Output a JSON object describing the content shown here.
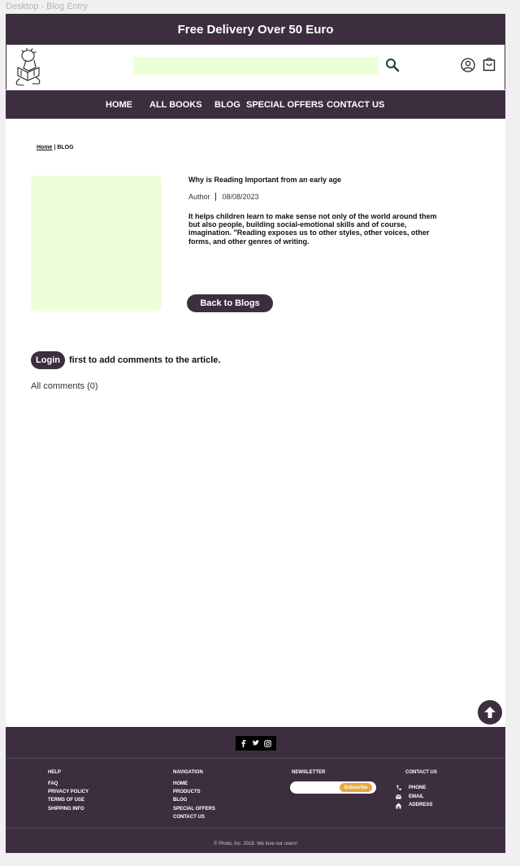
{
  "frame_label": "Desktop - Blog Entry",
  "promo": {
    "text": "Free Delivery Over 50 Euro"
  },
  "header": {
    "search_placeholder": "",
    "icons": {
      "search": "search-icon",
      "user": "user-icon",
      "cart": "cart-icon",
      "logo": "reading-child-logo"
    }
  },
  "nav": {
    "items": [
      {
        "label": "HOME"
      },
      {
        "label": "ALL BOOKS"
      },
      {
        "label": "BLOG"
      },
      {
        "label": "SPECIAL OFFERS"
      },
      {
        "label": "CONTACT US"
      }
    ]
  },
  "breadcrumb": {
    "home": "Home",
    "separator": "|",
    "current": "BLOG"
  },
  "post": {
    "title": "Why is Reading Important from an early age",
    "author": "Author",
    "date": "08/08/2023",
    "body": "It helps children learn to make sense not only of the world around them but also people, building social-emotional skills and of course, imagination. \"Reading exposes us to other styles, other voices, other forms, and other genres of writing.",
    "back_label": "Back to Blogs"
  },
  "comments": {
    "login_label": "Login",
    "login_message": "first to add comments to the article.",
    "count_label": "All comments (0)"
  },
  "footer": {
    "social": [
      "facebook-icon",
      "twitter-icon",
      "instagram-icon"
    ],
    "help": {
      "heading": "HELP",
      "links": [
        "FAQ",
        "PRIVACY POLICY",
        "TERMS OF USE",
        "SHIPPING INFO"
      ]
    },
    "navigation": {
      "heading": "NAVIGATION",
      "links": [
        "HOME",
        "PRODUCTS",
        "BLOG",
        "SPECIAL OFFERS",
        "CONTACT US"
      ]
    },
    "newsletter": {
      "heading": "NEWSLETTER",
      "placeholder": "",
      "button": "Subscribe"
    },
    "contact": {
      "heading": "CONTACT US",
      "items": [
        "PHONE",
        "EMAIL",
        "ADDRESS"
      ]
    },
    "copyright": "© Photo, Inc. 2019. We love our users!"
  },
  "colors": {
    "brand": "#3c2e3f",
    "accent": "#e8a83c",
    "placeholder_fill": "#ecffd9"
  }
}
